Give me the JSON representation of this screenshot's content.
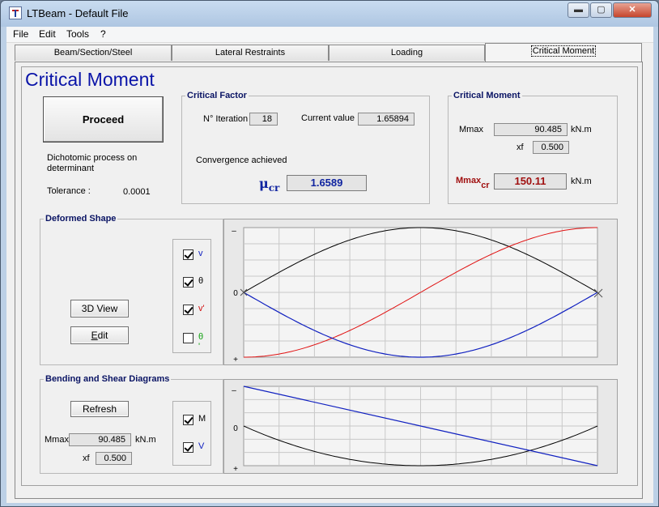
{
  "window": {
    "title": "LTBeam - Default File",
    "controls": {
      "minimize": "▬",
      "maximize": "▢",
      "close": "✕"
    }
  },
  "menu": [
    "File",
    "Edit",
    "Tools",
    "?"
  ],
  "tabs": [
    {
      "label": "Beam/Section/Steel"
    },
    {
      "label": "Lateral Restraints"
    },
    {
      "label": "Loading"
    },
    {
      "label": "Critical Moment",
      "active": true
    }
  ],
  "page": {
    "title": "Critical Moment",
    "proceed_label": "Proceed",
    "dichotomic_text": "Dichotomic process on determinant",
    "tolerance_label": "Tolerance :",
    "tolerance_value": "0.0001"
  },
  "critical_factor": {
    "title": "Critical Factor",
    "iteration_label": "N° Iteration",
    "iteration_value": "18",
    "current_label": "Current value",
    "current_value": "1.65894",
    "convergence_text": "Convergence achieved",
    "mu_symbol": "μ",
    "mu_sub": "cr",
    "mu_value": "1.6589"
  },
  "critical_moment": {
    "title": "Critical Moment",
    "mmax_label": "Mmax",
    "mmax_value": "90.485",
    "mmax_unit": "kN.m",
    "xf_label": "xf",
    "xf_value": "0.500",
    "mmaxcr_label": "Mmax",
    "mmaxcr_sub": "cr",
    "mmaxcr_value": "150.11",
    "mmaxcr_unit": "kN.m"
  },
  "deformed_shape": {
    "title": "Deformed Shape",
    "view3d_label": "3D View",
    "edit_label": "Edit",
    "edit_mnemonic": "E",
    "edit_rest": "dit",
    "checks": [
      {
        "label": "v",
        "checked": true,
        "color": "#1020c0"
      },
      {
        "label": "θ",
        "checked": true,
        "color": "#000000"
      },
      {
        "label": "v'",
        "checked": true,
        "color": "#d01010"
      },
      {
        "label": "θ '",
        "checked": false,
        "color": "#10a010"
      }
    ],
    "axis_labels": {
      "minus": "–",
      "zero": "0",
      "plus": "+"
    }
  },
  "bending_shear": {
    "title": "Bending and Shear Diagrams",
    "refresh_label": "Refresh",
    "mmax_label": "Mmax",
    "mmax_value": "90.485",
    "mmax_unit": "kN.m",
    "xf_label": "xf",
    "xf_value": "0.500",
    "checks": [
      {
        "label": "M",
        "checked": true,
        "color": "#000000"
      },
      {
        "label": "V",
        "checked": true,
        "color": "#1020c0"
      }
    ],
    "axis_labels": {
      "minus": "–",
      "zero": "0",
      "plus": "+"
    }
  },
  "colors": {
    "title_blue": "#0a14a8",
    "group_title": "#0a1464",
    "critical_red": "#a01010",
    "mu_blue": "#1024a0",
    "curve_v": "#1020c0",
    "curve_theta": "#000000",
    "curve_vprime": "#e01010"
  }
}
